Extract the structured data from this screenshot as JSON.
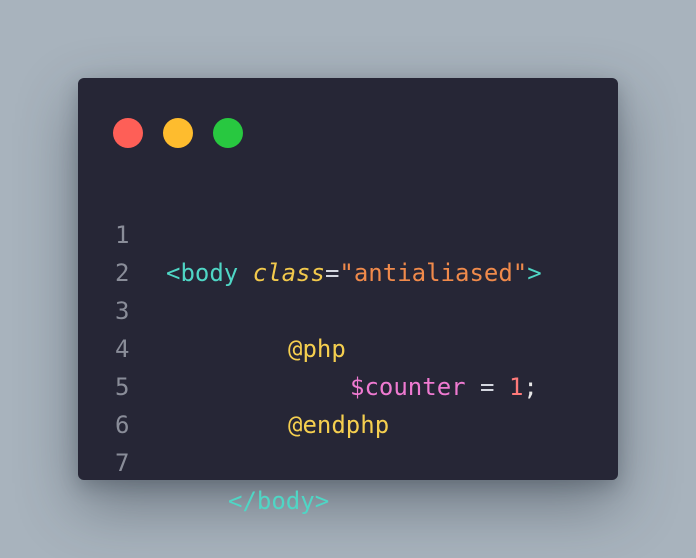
{
  "window": {
    "controls": [
      {
        "name": "close",
        "color": "#fe5f57"
      },
      {
        "name": "minimize",
        "color": "#febc2e"
      },
      {
        "name": "maximize",
        "color": "#28c840"
      }
    ]
  },
  "code": {
    "lines": [
      {
        "number": "1",
        "tokens": [
          "<body ",
          "class",
          "=",
          "\"antialiased\"",
          ">"
        ]
      },
      {
        "number": "2",
        "tokens": []
      },
      {
        "number": "3",
        "tokens": [
          "@php"
        ]
      },
      {
        "number": "4",
        "tokens": [
          "$counter",
          " = ",
          "1",
          ";"
        ]
      },
      {
        "number": "5",
        "tokens": [
          "@endphp"
        ]
      },
      {
        "number": "6",
        "tokens": []
      },
      {
        "number": "7",
        "tokens": [
          "</body>"
        ]
      }
    ]
  },
  "colors": {
    "background": "#a8b3bd",
    "editor": "#262636",
    "line_number": "#8a8d99",
    "tag": "#4fd6c5",
    "attribute": "#f2c94c",
    "string": "#f08a4b",
    "directive": "#f5cf4f",
    "variable": "#ef7ad1",
    "number": "#ff7a7a"
  }
}
